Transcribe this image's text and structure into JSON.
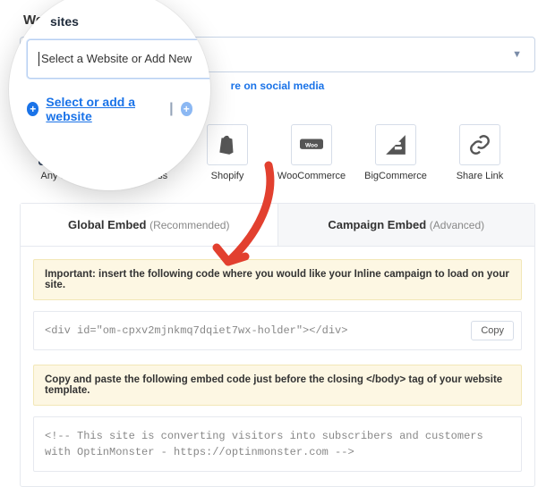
{
  "header": {
    "title": "Websites"
  },
  "social_text": "re on social media",
  "lens": {
    "title": "sites",
    "placeholder": "Select a Website or Add New",
    "action_link": "Select or add a website",
    "separator": "|"
  },
  "platforms": [
    {
      "label": "Any Site",
      "icon": "globe-icon"
    },
    {
      "label": "WordPress",
      "icon": "wordpress-icon"
    },
    {
      "label": "Shopify",
      "icon": "shopify-icon"
    },
    {
      "label": "WooCommerce",
      "icon": "woocommerce-icon"
    },
    {
      "label": "BigCommerce",
      "icon": "bigcommerce-icon"
    },
    {
      "label": "Share Link",
      "icon": "link-icon"
    }
  ],
  "tabs": {
    "global": {
      "main": "Global Embed",
      "sub": "(Recommended)"
    },
    "campaign": {
      "main": "Campaign Embed",
      "sub": "(Advanced)"
    }
  },
  "embed": {
    "warn1": "Important: insert the following code where you would like your Inline campaign to load on your site.",
    "code1": "<div id=\"om-cpxv2mjnkmq7dqiet7wx-holder\"></div>",
    "copy_label": "Copy",
    "warn2": "Copy and paste the following embed code just before the closing </body> tag of your website template.",
    "code2": "<!-- This site is converting visitors into subscribers and customers with OptinMonster - https://optinmonster.com -->"
  }
}
